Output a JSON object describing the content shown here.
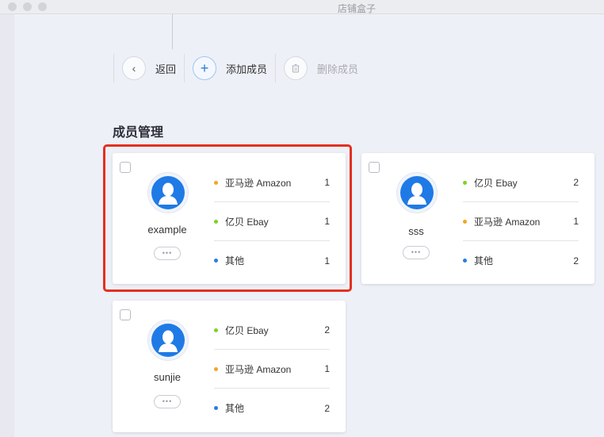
{
  "window": {
    "title": "店铺盒子"
  },
  "toolbar": {
    "back_label": "返回",
    "back_icon": "‹",
    "add_label": "添加成员",
    "add_icon": "+",
    "delete_label": "删除成员"
  },
  "section": {
    "title": "成员管理"
  },
  "colors": {
    "amazon": "#f5a623",
    "ebay": "#7ed321",
    "other": "#2a7de1",
    "highlight": "#e3301f"
  },
  "members": [
    {
      "name": "example",
      "more": "•••",
      "platforms": [
        {
          "name": "亚马逊 Amazon",
          "count": "1",
          "color": "#f5a623"
        },
        {
          "name": "亿贝 Ebay",
          "count": "1",
          "color": "#7ed321"
        },
        {
          "name": "其他",
          "count": "1",
          "color": "#2a7de1"
        }
      ]
    },
    {
      "name": "sss",
      "more": "•••",
      "platforms": [
        {
          "name": "亿贝 Ebay",
          "count": "2",
          "color": "#7ed321"
        },
        {
          "name": "亚马逊 Amazon",
          "count": "1",
          "color": "#f5a623"
        },
        {
          "name": "其他",
          "count": "2",
          "color": "#2a7de1"
        }
      ]
    },
    {
      "name": "sunjie",
      "more": "•••",
      "platforms": [
        {
          "name": "亿贝 Ebay",
          "count": "2",
          "color": "#7ed321"
        },
        {
          "name": "亚马逊 Amazon",
          "count": "1",
          "color": "#f5a623"
        },
        {
          "name": "其他",
          "count": "2",
          "color": "#2a7de1"
        }
      ]
    }
  ]
}
